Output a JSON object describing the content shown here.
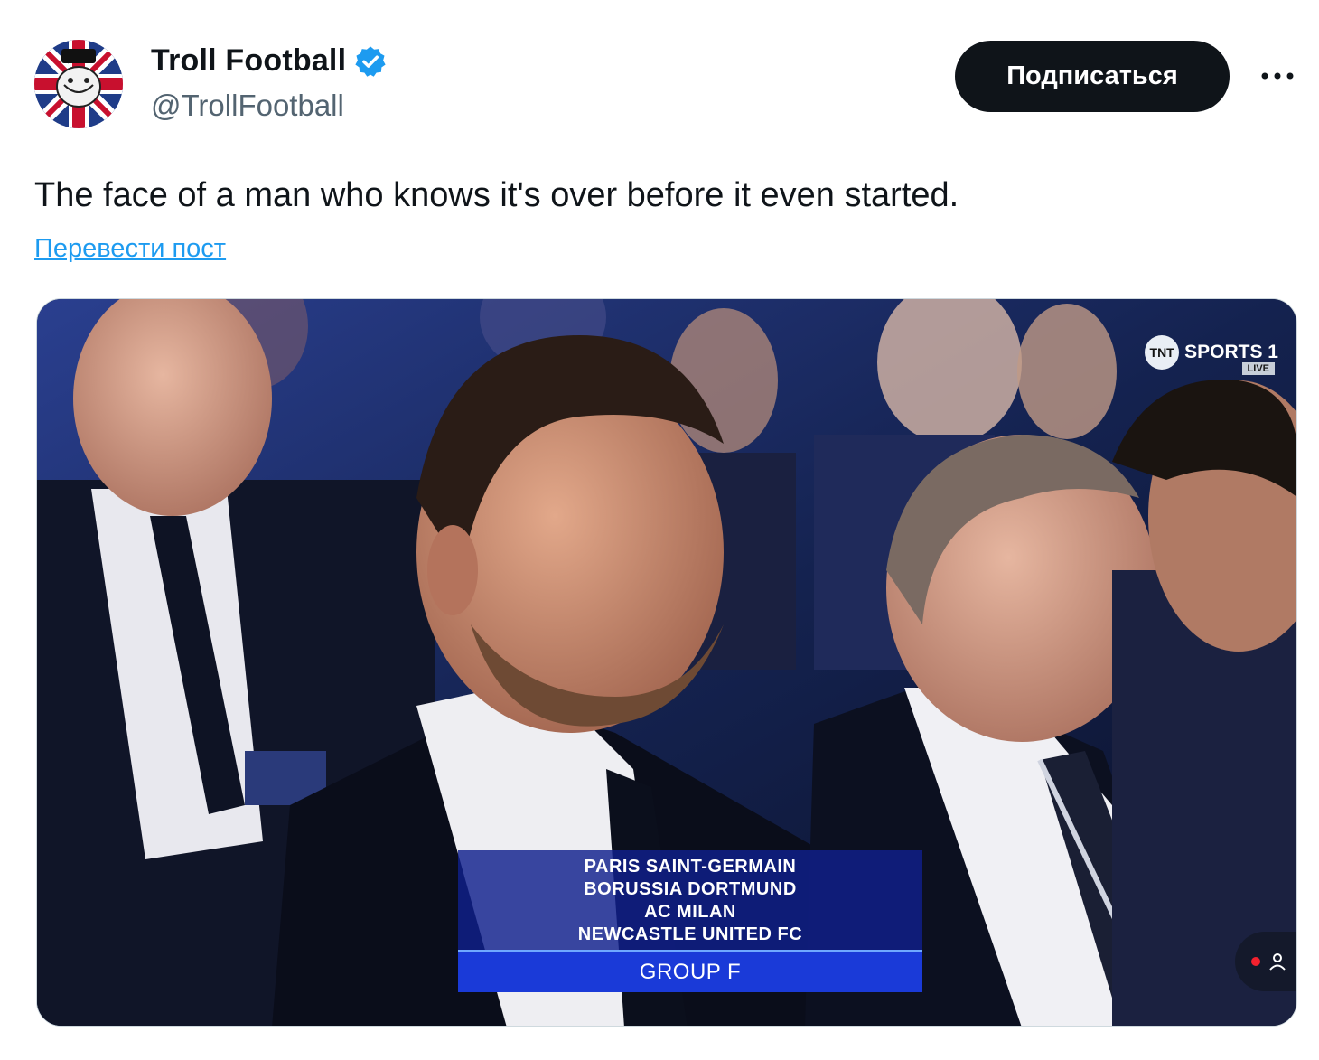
{
  "author": {
    "display_name": "Troll Football",
    "handle": "@TrollFootball",
    "avatar_icon": "troll-face-union-jack-avatar",
    "verified_icon": "verified-badge-icon",
    "verified_color": "#1d9bf0"
  },
  "header": {
    "follow_label": "Подписаться",
    "more_icon": "more-icon"
  },
  "post": {
    "text": "The face of a man who knows it's over before it even started.",
    "translate_label": "Перевести пост"
  },
  "media": {
    "broadcaster": "SPORTS 1",
    "broadcaster_logo": "TNT",
    "live_tag": "LIVE",
    "group_teams": [
      "PARIS SAINT-GERMAIN",
      "BORUSSIA DORTMUND",
      "AC MILAN",
      "NEWCASTLE UNITED FC"
    ],
    "group_label": "GROUP F",
    "pip_icon": "live-viewers-icon"
  }
}
